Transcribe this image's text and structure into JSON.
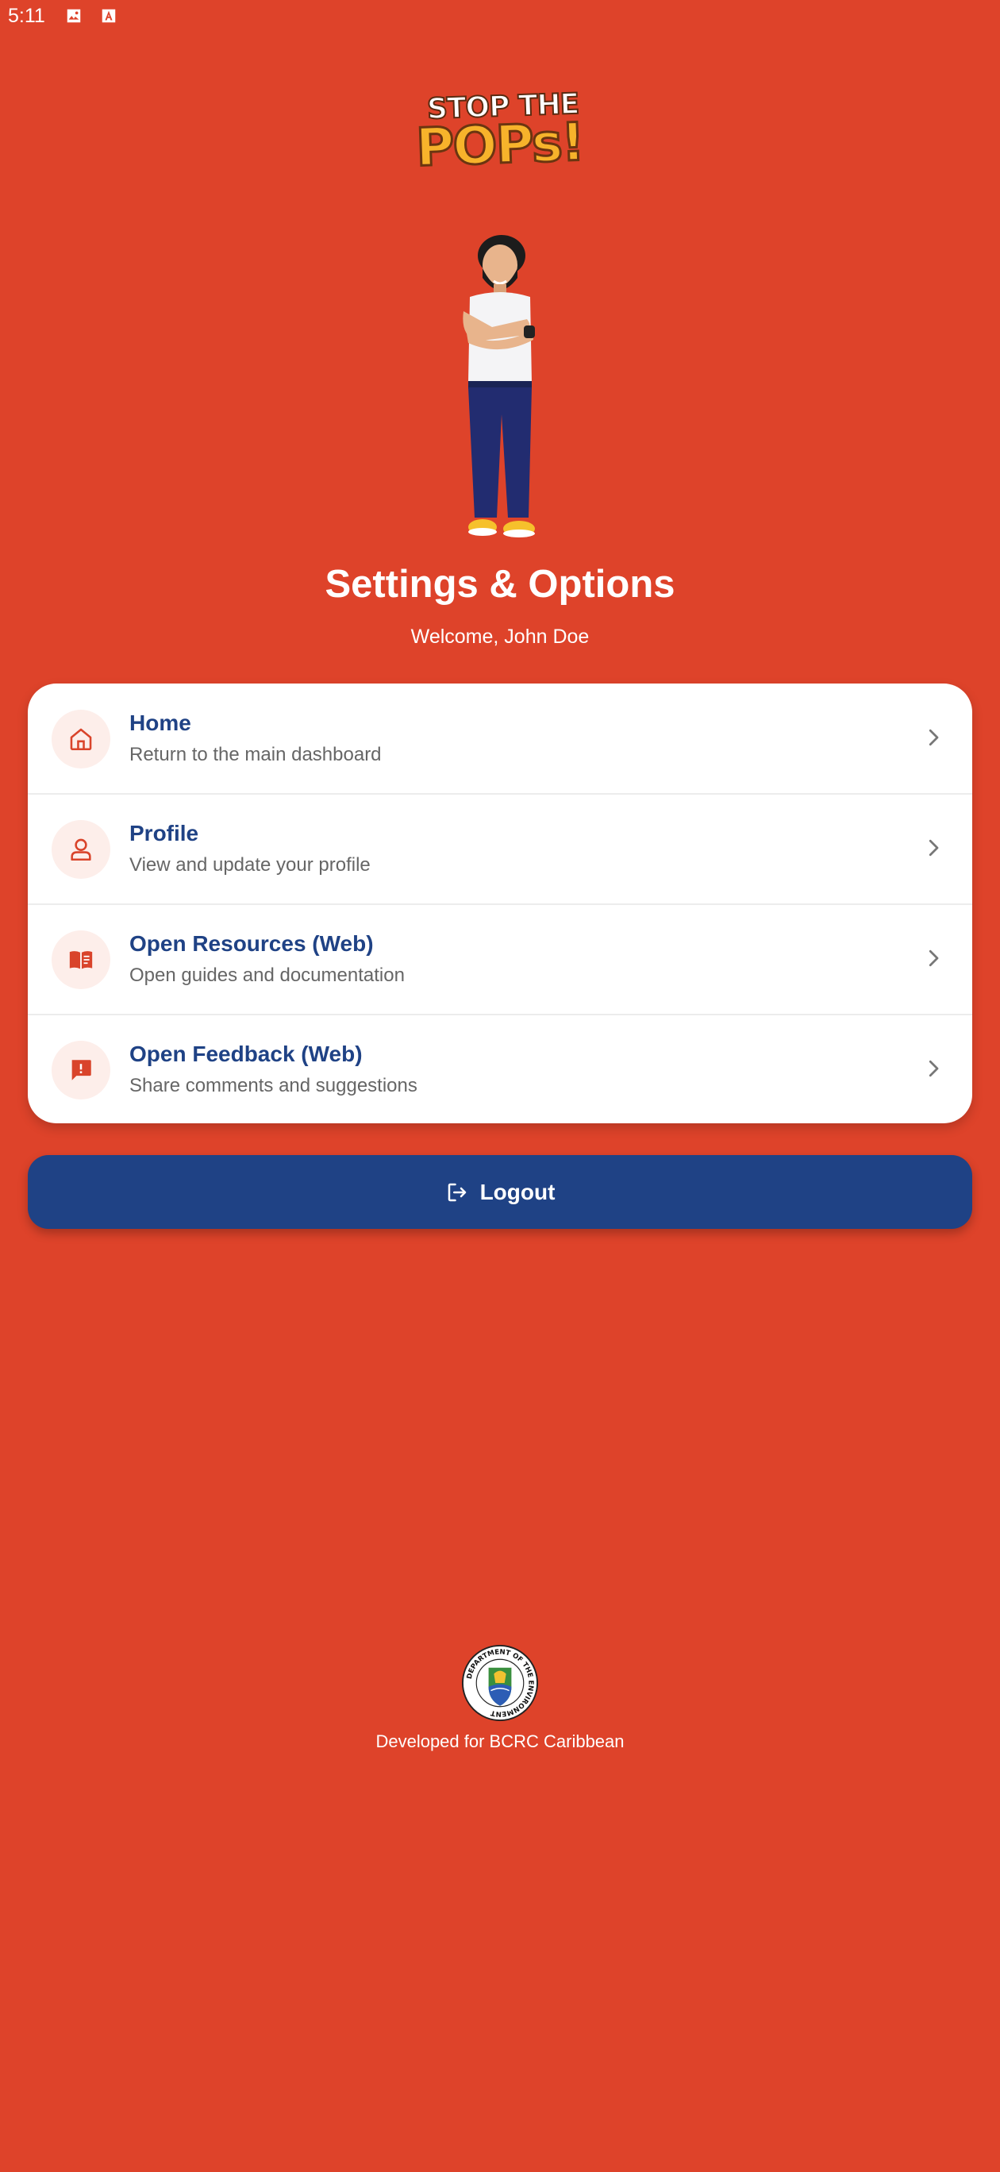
{
  "status_bar": {
    "time": "5:11",
    "icons": [
      "image-icon",
      "font-icon"
    ]
  },
  "logo": {
    "line1": "STOP THE",
    "line2": "POPs!"
  },
  "header": {
    "title": "Settings & Options",
    "welcome": "Welcome, John Doe"
  },
  "menu": {
    "items": [
      {
        "icon": "home-icon",
        "title": "Home",
        "subtitle": "Return to the main dashboard"
      },
      {
        "icon": "person-icon",
        "title": "Profile",
        "subtitle": "View and update your profile"
      },
      {
        "icon": "book-icon",
        "title": "Open Resources (Web)",
        "subtitle": "Open guides and documentation"
      },
      {
        "icon": "feedback-icon",
        "title": "Open Feedback (Web)",
        "subtitle": "Share comments and suggestions"
      }
    ]
  },
  "logout": {
    "label": "Logout",
    "icon": "logout-icon"
  },
  "footer": {
    "seal_text": "DEPARTMENT OF THE ENVIRONMENT",
    "text": "Developed for BCRC Caribbean"
  },
  "colors": {
    "background": "#DE432A",
    "primary_blue": "#1F4285",
    "icon_bg": "#FDEEEA",
    "icon_accent": "#D9442B"
  }
}
